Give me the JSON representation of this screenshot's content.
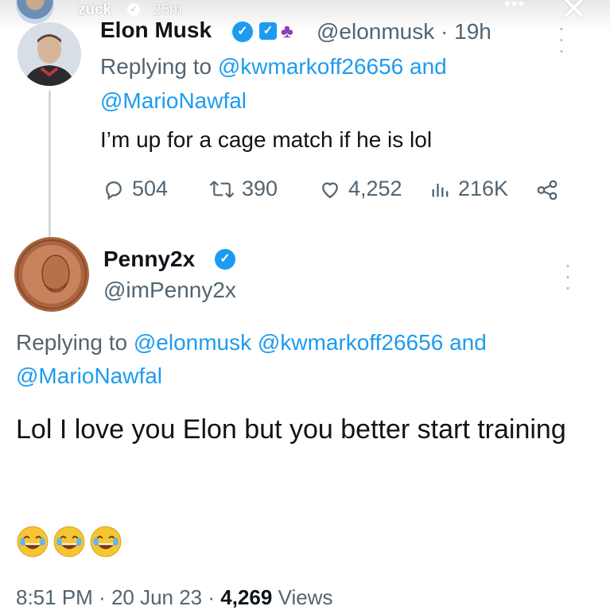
{
  "story": {
    "username": "zuck",
    "time": "25m"
  },
  "tweet1": {
    "name": "Elon Musk",
    "handle": "@elonmusk",
    "time": "19h",
    "replying_prefix": "Replying to",
    "reply_to_1": "@kwmarkoff26656",
    "reply_and": "and",
    "reply_to_2": "@MarioNawfal",
    "text": "I’m up for a cage match if he is lol",
    "metrics": {
      "replies": "504",
      "retweets": "390",
      "likes": "4,252",
      "views": "216K"
    }
  },
  "tweet2": {
    "name": "Penny2x",
    "handle": "@imPenny2x",
    "replying_prefix": "Replying to",
    "reply_to_1": "@elonmusk",
    "reply_to_2": "@kwmarkoff26656",
    "reply_and": "and",
    "reply_to_3": "@MarioNawfal",
    "text": "Lol I love you Elon but you better start training",
    "emojis": [
      "😂",
      "😂",
      "😂"
    ],
    "footer_time": "8:51 PM",
    "footer_date": "20 Jun 23",
    "footer_views_count": "4,269",
    "footer_views_label": "Views"
  },
  "colors": {
    "accent": "#1d9bf0",
    "secondary_text": "#536471",
    "primary_text": "#0f1419"
  }
}
